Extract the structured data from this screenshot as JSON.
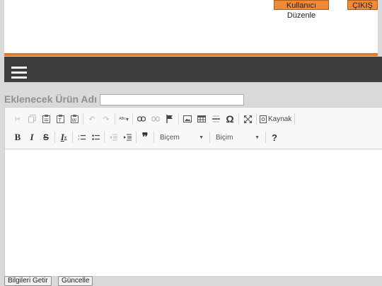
{
  "header": {
    "user_edit_label": "Kullanıcı Düzenle",
    "logout_label": "ÇIKIŞ"
  },
  "form": {
    "product_name_label": "Eklenecek Ürün Adı",
    "product_name_value": ""
  },
  "toolbar": {
    "source_label": "Kaynak",
    "styles_combo_label": "Biçem",
    "format_combo_label": "Biçim",
    "help_label": "?",
    "icons_row1": [
      "cut-icon",
      "copy-icon",
      "paste-icon",
      "paste-text-icon",
      "paste-word-icon",
      "undo-icon",
      "redo-icon",
      "spellcheck-icon",
      "link-icon",
      "unlink-icon",
      "anchor-icon",
      "image-icon",
      "table-icon",
      "horizontal-line-icon",
      "special-char-icon",
      "maximize-icon",
      "source-icon"
    ],
    "icons_row2": [
      "bold-icon",
      "italic-icon",
      "strikethrough-icon",
      "remove-format-icon",
      "numbered-list-icon",
      "bulleted-list-icon",
      "outdent-icon",
      "indent-icon",
      "blockquote-icon"
    ]
  },
  "buttons": {
    "get_info_label": "Bilgileri Getir",
    "update_label": "Güncelle"
  },
  "colors": {
    "accent": "#f08a37",
    "navbar": "#3d3d3d",
    "stripe": "#e2792c"
  }
}
